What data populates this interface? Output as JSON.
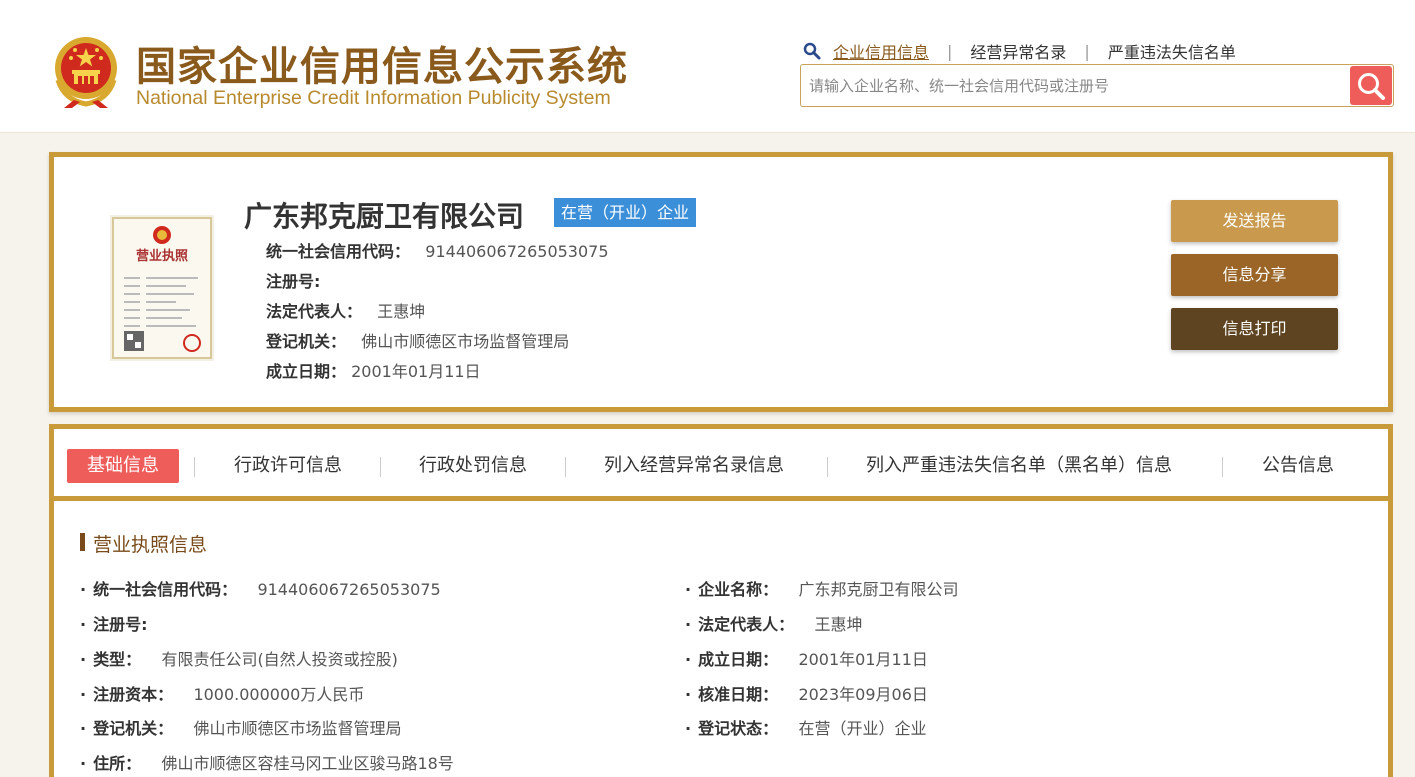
{
  "header": {
    "title_cn": "国家企业信用信息公示系统",
    "title_en": "National Enterprise Credit Information Publicity System",
    "links": [
      {
        "label": "企业信用信息",
        "active": true
      },
      {
        "label": "经营异常名录",
        "active": false
      },
      {
        "label": "严重违法失信名单",
        "active": false
      }
    ],
    "search_placeholder": "请输入企业名称、统一社会信用代码或注册号",
    "search_value": ""
  },
  "company": {
    "name": "广东邦克厨卫有限公司",
    "status": "在营（开业）企业",
    "fields": [
      {
        "key": "统一社会信用代码：",
        "value": "914406067265053075"
      },
      {
        "key": "注册号:",
        "value": ""
      },
      {
        "key": "法定代表人：",
        "value": "王惠坤"
      },
      {
        "key": "登记机关：",
        "value": "佛山市顺德区市场监督管理局"
      },
      {
        "key": "成立日期：",
        "value": "2001年01月11日"
      }
    ],
    "license_text": "营业执照"
  },
  "actions": {
    "send": "发送报告",
    "share": "信息分享",
    "print": "信息打印"
  },
  "tabs": [
    {
      "label": "基础信息",
      "active": true
    },
    {
      "label": "行政许可信息",
      "active": false
    },
    {
      "label": "行政处罚信息",
      "active": false
    },
    {
      "label": "列入经营异常名录信息",
      "active": false
    },
    {
      "label": "列入严重违法失信名单（黑名单）信息",
      "active": false
    },
    {
      "label": "公告信息",
      "active": false
    }
  ],
  "license_section": {
    "title": "营业执照信息",
    "left": [
      {
        "key": "统一社会信用代码：",
        "value": "914406067265053075"
      },
      {
        "key": "注册号:",
        "value": ""
      },
      {
        "key": "类型：",
        "value": "有限责任公司(自然人投资或控股)"
      },
      {
        "key": "注册资本：",
        "value": "1000.000000万人民币"
      },
      {
        "key": "登记机关：",
        "value": "佛山市顺德区市场监督管理局"
      },
      {
        "key": "住所：",
        "value": "佛山市顺德区容桂马冈工业区骏马路18号"
      }
    ],
    "right": [
      {
        "key": "企业名称：",
        "value": "广东邦克厨卫有限公司"
      },
      {
        "key": "法定代表人：",
        "value": "王惠坤"
      },
      {
        "key": "成立日期：",
        "value": "2001年01月11日"
      },
      {
        "key": "核准日期：",
        "value": "2023年09月06日"
      },
      {
        "key": "登记状态：",
        "value": "在营（开业）企业"
      }
    ]
  },
  "colors": {
    "brand_gold": "#c99a3a",
    "brand_brown": "#8a5a1c",
    "accent_red": "#ef5d5a",
    "status_blue": "#3b8fd9"
  }
}
